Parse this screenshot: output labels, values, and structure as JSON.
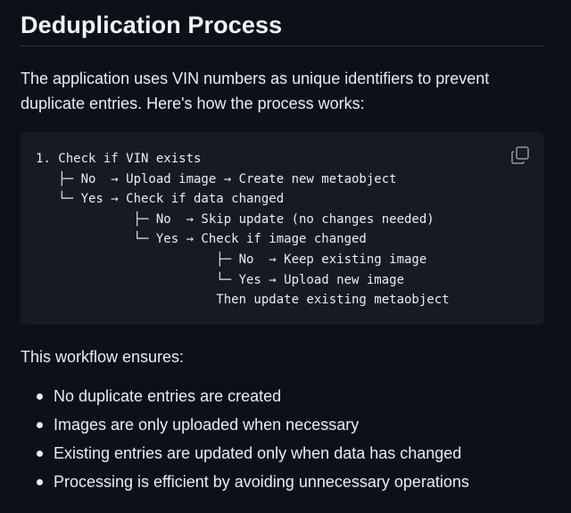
{
  "heading": "Deduplication Process",
  "intro": "The application uses VIN numbers as unique identifiers to prevent duplicate entries. Here's how the process works:",
  "code": {
    "lines": [
      "1. Check if VIN exists",
      "   ├─ No  → Upload image → Create new metaobject",
      "   └─ Yes → Check if data changed",
      "             ├─ No  → Skip update (no changes needed)",
      "             └─ Yes → Check if image changed",
      "                        ├─ No  → Keep existing image",
      "                        └─ Yes → Upload new image",
      "                        Then update existing metaobject"
    ],
    "copy_icon": "copy-icon"
  },
  "workflow_lead": "This workflow ensures:",
  "bullets": [
    "No duplicate entries are created",
    "Images are only uploaded when necessary",
    "Existing entries are updated only when data has changed",
    "Processing is efficient by avoiding unnecessary operations"
  ]
}
